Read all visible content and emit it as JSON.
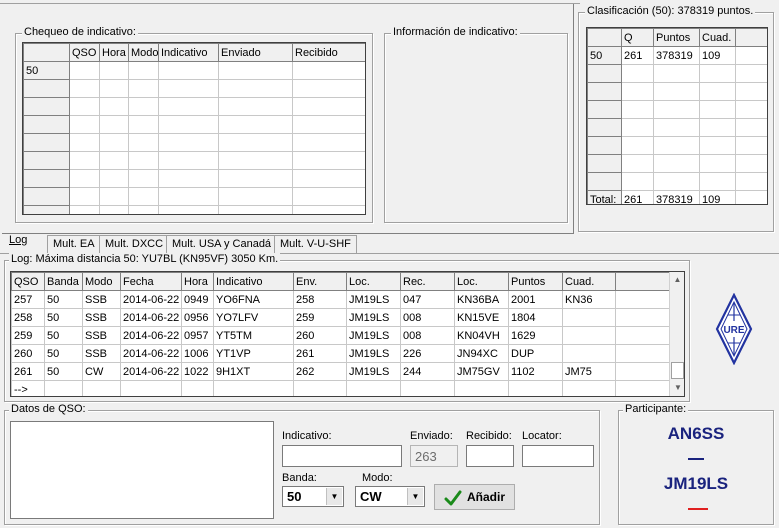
{
  "callsign_check": {
    "title": "Chequeo de indicativo:",
    "headers": [
      "",
      "QSO",
      "Hora",
      "Modo",
      "Indicativo",
      "Enviado",
      "Recibido"
    ],
    "rows": [
      [
        "50",
        "",
        "",
        "",
        "",
        "",
        ""
      ],
      [
        "",
        "",
        "",
        "",
        "",
        "",
        ""
      ],
      [
        "",
        "",
        "",
        "",
        "",
        "",
        ""
      ],
      [
        "",
        "",
        "",
        "",
        "",
        "",
        ""
      ],
      [
        "",
        "",
        "",
        "",
        "",
        "",
        ""
      ],
      [
        "",
        "",
        "",
        "",
        "",
        "",
        ""
      ],
      [
        "",
        "",
        "",
        "",
        "",
        "",
        ""
      ],
      [
        "",
        "",
        "",
        "",
        "",
        "",
        ""
      ],
      [
        "",
        "",
        "",
        "",
        "",
        "",
        ""
      ]
    ]
  },
  "callsign_info": {
    "title": "Información de indicativo:"
  },
  "classification": {
    "title": "Clasificación (50): 378319 puntos.",
    "headers": [
      "",
      "Q",
      "Puntos",
      "Cuad.",
      ""
    ],
    "rows": [
      [
        "50",
        "261",
        "378319",
        "109",
        ""
      ],
      [
        "",
        "",
        "",
        "",
        ""
      ],
      [
        "",
        "",
        "",
        "",
        ""
      ],
      [
        "",
        "",
        "",
        "",
        ""
      ],
      [
        "",
        "",
        "",
        "",
        ""
      ],
      [
        "",
        "",
        "",
        "",
        ""
      ],
      [
        "",
        "",
        "",
        "",
        ""
      ],
      [
        "",
        "",
        "",
        "",
        ""
      ],
      [
        "Total:",
        "261",
        "378319",
        "109",
        ""
      ]
    ]
  },
  "tabs": {
    "log": "Log",
    "mult_ea": "Mult. EA",
    "mult_dxcc": "Mult. DXCC",
    "mult_usa": "Mult. USA y Canadá",
    "mult_vushf": "Mult. V-U-SHF"
  },
  "log": {
    "title": "Log: Máxima distancia 50: YU7BL (KN95VF) 3050 Km.",
    "headers": [
      "QSO",
      "Banda",
      "Modo",
      "Fecha",
      "Hora",
      "Indicativo",
      "Env.",
      "Loc.",
      "Rec.",
      "Loc.",
      "Puntos",
      "Cuad.",
      ""
    ],
    "rows": [
      [
        "257",
        "50",
        "SSB",
        "2014-06-22",
        "0949",
        "YO6FNA",
        "258",
        "JM19LS",
        "047",
        "KN36BA",
        "2001",
        "KN36",
        ""
      ],
      [
        "258",
        "50",
        "SSB",
        "2014-06-22",
        "0956",
        "YO7LFV",
        "259",
        "JM19LS",
        "008",
        "KN15VE",
        "1804",
        "",
        ""
      ],
      [
        "259",
        "50",
        "SSB",
        "2014-06-22",
        "0957",
        "YT5TM",
        "260",
        "JM19LS",
        "008",
        "KN04VH",
        "1629",
        "",
        ""
      ],
      [
        "260",
        "50",
        "SSB",
        "2014-06-22",
        "1006",
        "YT1VP",
        "261",
        "JM19LS",
        "226",
        "JN94XC",
        "DUP",
        "",
        ""
      ],
      [
        "261",
        "50",
        "CW",
        "2014-06-22",
        "1022",
        "9H1XT",
        "262",
        "JM19LS",
        "244",
        "JM75GV",
        "1102",
        "JM75",
        ""
      ],
      [
        "-->",
        "",
        "",
        "",
        "",
        "",
        "",
        "",
        "",
        "",
        "",
        "",
        ""
      ]
    ]
  },
  "qso_data": {
    "title": "Datos de QSO:",
    "callsign_label": "Indicativo:",
    "callsign_value": "",
    "sent_label": "Enviado:",
    "sent_value": "263",
    "received_label": "Recibido:",
    "received_value": "",
    "locator_label": "Locator:",
    "locator_value": "",
    "band_label": "Banda:",
    "band_value": "50",
    "mode_label": "Modo:",
    "mode_value": "CW",
    "add_button": "Añadir"
  },
  "participant": {
    "title": "Participante:",
    "callsign": "AN6SS",
    "locator": "JM19LS",
    "name_color": "#1a237e",
    "dash_color": "#e02020"
  },
  "logo": {
    "text": "URE",
    "color": "#2233a0"
  }
}
